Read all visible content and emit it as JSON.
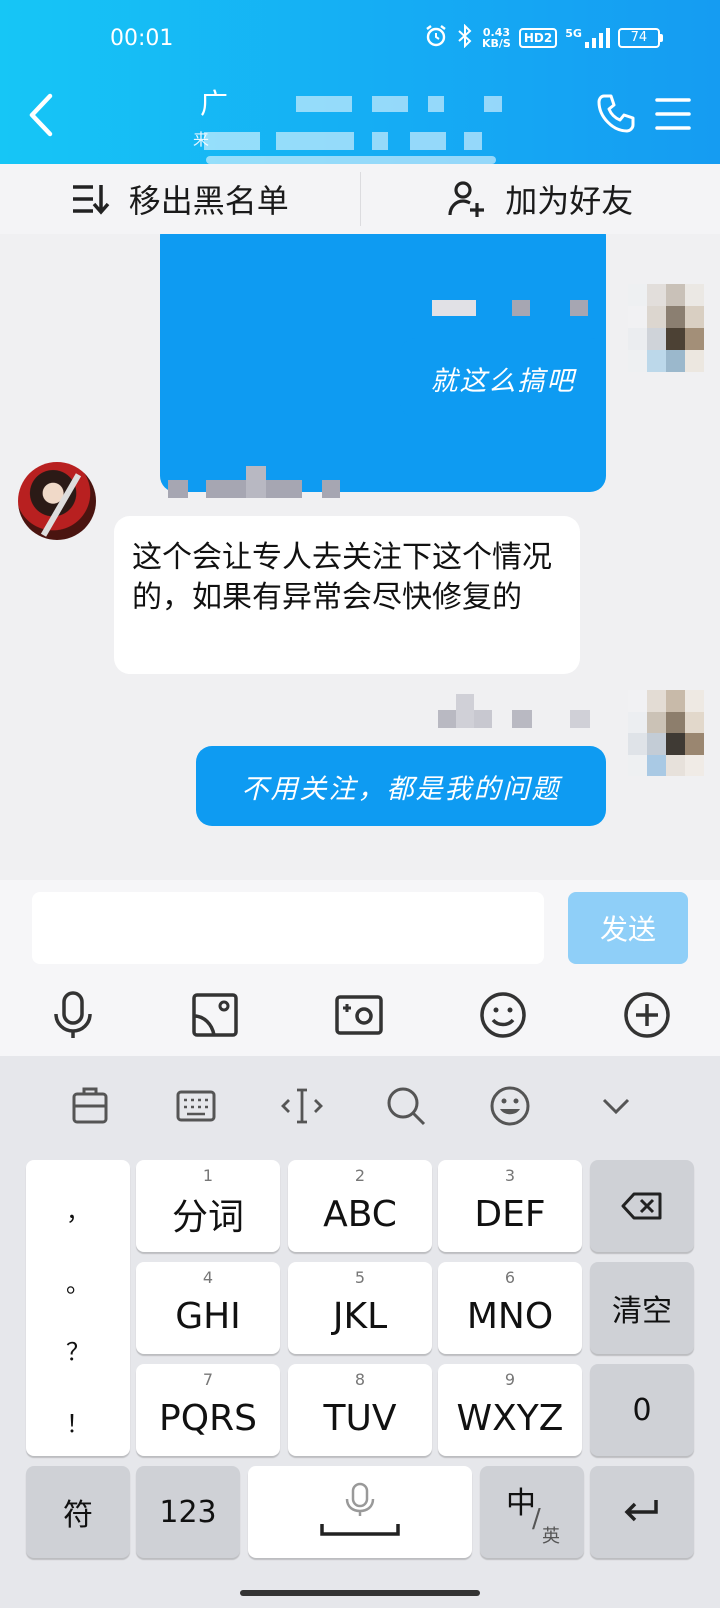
{
  "status_bar": {
    "time": "00:01",
    "net_speed_value": "0.43",
    "net_speed_unit": "KB/S",
    "hd_badge": "HD2",
    "signal_label": "5G",
    "battery": "74"
  },
  "header": {
    "contact_name_visible": "广",
    "contact_sub_visible": "来"
  },
  "action_bar": {
    "remove_blacklist": "移出黑名单",
    "add_friend": "加为好友"
  },
  "messages": [
    {
      "side": "out",
      "text": "就这么搞吧"
    },
    {
      "side": "in",
      "text": "这个会让专人去关注下这个情况的，如果有异常会尽快修复的"
    },
    {
      "side": "out",
      "text": "不用关注，都是我的问题"
    }
  ],
  "composer": {
    "input_value": "",
    "send_label": "发送"
  },
  "toolbar_icons": [
    "microphone-icon",
    "image-icon",
    "camera-icon",
    "emoji-icon",
    "plus-icon"
  ],
  "keyboard": {
    "tool_icons": [
      "clipboard-icon",
      "keyboard-icon",
      "cursor-icon",
      "search-icon",
      "emoji-icon",
      "chevron-down-icon"
    ],
    "punctuation": [
      "，",
      "。",
      "？",
      "！"
    ],
    "keys": [
      {
        "num": "1",
        "label": "分词"
      },
      {
        "num": "2",
        "label": "ABC"
      },
      {
        "num": "3",
        "label": "DEF"
      },
      {
        "num": "4",
        "label": "GHI"
      },
      {
        "num": "5",
        "label": "JKL"
      },
      {
        "num": "6",
        "label": "MNO"
      },
      {
        "num": "7",
        "label": "PQRS"
      },
      {
        "num": "8",
        "label": "TUV"
      },
      {
        "num": "9",
        "label": "WXYZ"
      }
    ],
    "clear_label": "清空",
    "zero_label": "0",
    "symbol_label": "符",
    "numeric_label": "123",
    "lang_main": "中",
    "lang_sub": "英"
  },
  "colors": {
    "header_start": "#16c6f6",
    "header_end": "#159cf2",
    "bubble_out": "#0e9bf2",
    "send_disabled": "#8fcff8"
  }
}
